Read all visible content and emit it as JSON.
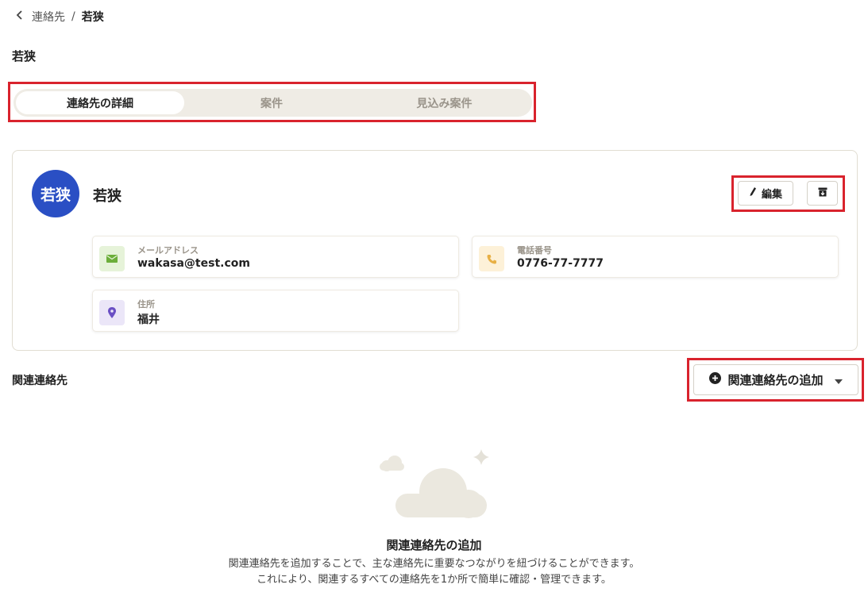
{
  "breadcrumb": {
    "parent": "連絡先",
    "separator": "/",
    "current": "若狭"
  },
  "page_title": "若狭",
  "tabs": [
    {
      "label": "連絡先の詳細",
      "active": true
    },
    {
      "label": "案件",
      "active": false
    },
    {
      "label": "見込み案件",
      "active": false
    }
  ],
  "contact": {
    "avatar_text": "若狭",
    "name": "若狭",
    "edit_label": "編集",
    "email": {
      "label": "メールアドレス",
      "value": "wakasa@test.com",
      "icon": "mail-icon"
    },
    "phone": {
      "label": "電話番号",
      "value": "0776-77-7777",
      "icon": "phone-icon"
    },
    "address": {
      "label": "住所",
      "value": "福井",
      "icon": "location-pin-icon"
    }
  },
  "related": {
    "title": "関連連絡先",
    "add_button_label": "関連連絡先の追加",
    "empty_title": "関連連絡先の追加",
    "empty_line1": "関連連絡先を追加することで、主な連絡先に重要なつながりを紐づけることができます。",
    "empty_line2": "これにより、関連するすべての連絡先を1か所で簡単に確認・管理できます。"
  },
  "colors": {
    "accent_blue": "#2a4fc4",
    "highlight_red": "#d9232d",
    "tab_bg": "#efece5"
  }
}
